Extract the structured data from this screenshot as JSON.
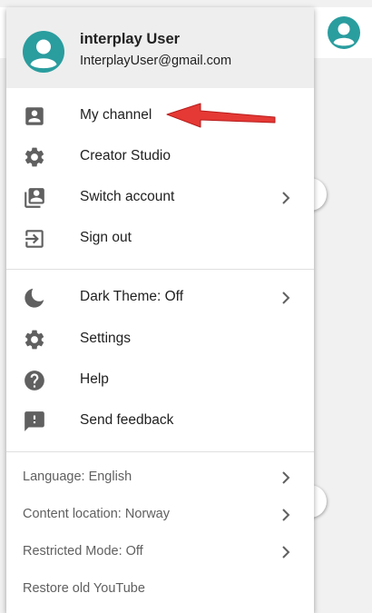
{
  "account": {
    "name": "interplay User",
    "email": "InterplayUser@gmail.com",
    "avatar_color": "#2a9d9f"
  },
  "menu": {
    "section1": [
      {
        "label": "My channel",
        "icon": "person-box-icon"
      },
      {
        "label": "Creator Studio",
        "icon": "gear-icon"
      },
      {
        "label": "Switch account",
        "icon": "switch-account-icon",
        "has_submenu": true
      },
      {
        "label": "Sign out",
        "icon": "sign-out-icon"
      }
    ],
    "section2": [
      {
        "label": "Dark Theme: Off",
        "icon": "moon-icon",
        "has_submenu": true
      },
      {
        "label": "Settings",
        "icon": "gear-icon"
      },
      {
        "label": "Help",
        "icon": "help-icon"
      },
      {
        "label": "Send feedback",
        "icon": "feedback-icon"
      }
    ],
    "footer": [
      {
        "label": "Language: English",
        "has_submenu": true
      },
      {
        "label": "Content location: Norway",
        "has_submenu": true
      },
      {
        "label": "Restricted Mode: Off",
        "has_submenu": true
      },
      {
        "label": "Restore old YouTube"
      }
    ]
  },
  "colors": {
    "icon": "#606060",
    "header_bg": "#eeeeee",
    "annotation_arrow": "#e53935"
  }
}
